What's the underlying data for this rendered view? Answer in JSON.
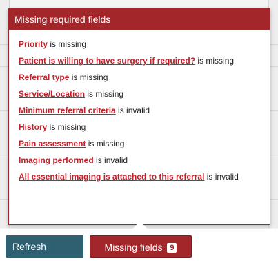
{
  "popover": {
    "title": "Missing required fields",
    "items": [
      {
        "field": "Priority",
        "status": " is missing"
      },
      {
        "field": "Patient is willing to have surgery if required?",
        "status": " is missing"
      },
      {
        "field": "Referral type",
        "status": " is missing"
      },
      {
        "field": "Service/Location",
        "status": " is missing"
      },
      {
        "field": "Minimum referral criteria",
        "status": " is invalid"
      },
      {
        "field": "History",
        "status": " is missing"
      },
      {
        "field": "Pain assessment",
        "status": " is missing"
      },
      {
        "field": "Imaging performed",
        "status": " is invalid"
      },
      {
        "field": "All essential imaging is attached to this referral",
        "status": " is invalid"
      }
    ]
  },
  "buttons": {
    "refresh": "Refresh",
    "missing_fields": "Missing fields",
    "missing_count": "9"
  },
  "colors": {
    "accent": "#a3262a",
    "refresh": "#2e6072",
    "link": "#c0202a"
  }
}
